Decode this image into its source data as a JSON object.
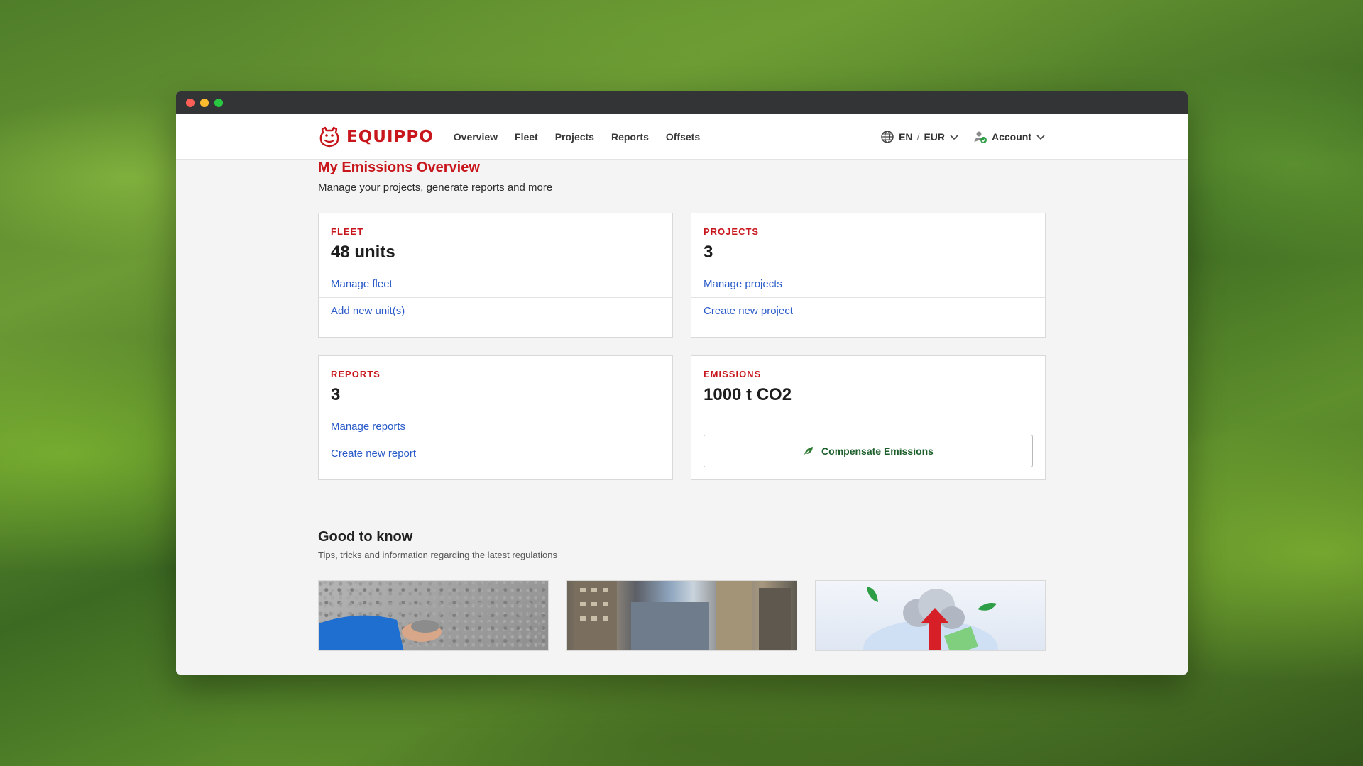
{
  "brand": {
    "name": "EQUIPPO",
    "accent": "#c8161d"
  },
  "nav": {
    "links": [
      "Overview",
      "Fleet",
      "Projects",
      "Reports",
      "Offsets"
    ],
    "language": "EN",
    "separator": "/",
    "currency": "EUR",
    "account": "Account"
  },
  "page": {
    "title": "My Emissions Overview",
    "subtitle": "Manage your projects, generate reports and more"
  },
  "cards": {
    "fleet": {
      "label": "FLEET",
      "value": "48 units",
      "link1": "Manage fleet",
      "link2": "Add new unit(s)"
    },
    "projects": {
      "label": "PROJECTS",
      "value": "3",
      "link1": "Manage projects",
      "link2": "Create new project"
    },
    "reports": {
      "label": "REPORTS",
      "value": "3",
      "link1": "Manage reports",
      "link2": "Create new report"
    },
    "emissions": {
      "label": "EMISSIONS",
      "value": "1000 t CO2",
      "button": "Compensate Emissions"
    }
  },
  "good_to_know": {
    "title": "Good to know",
    "subtitle": "Tips, tricks and information regarding the latest regulations"
  },
  "icons": [
    "hippo-logo-icon",
    "globe-icon",
    "chevron-down-icon",
    "account-verified-icon",
    "leaf-icon"
  ]
}
